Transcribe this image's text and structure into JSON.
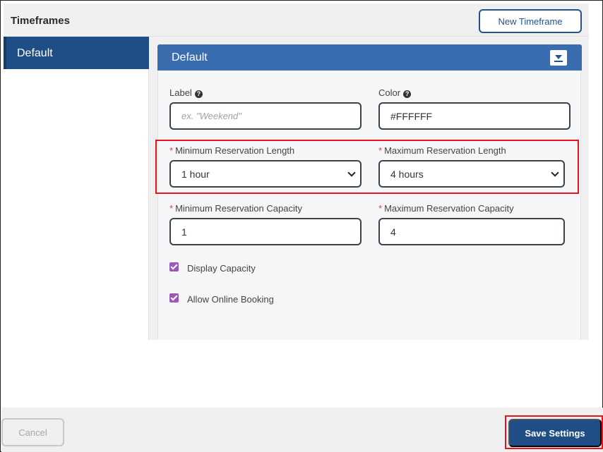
{
  "header": {
    "title": "Timeframes",
    "new_button_label": "New Timeframe"
  },
  "sidebar": {
    "items": [
      {
        "label": "Default"
      }
    ]
  },
  "panel": {
    "title": "Default",
    "label_field": {
      "label": "Label",
      "placeholder": "ex. \"Weekend\"",
      "value": ""
    },
    "color_field": {
      "label": "Color",
      "value": "#FFFFFF"
    },
    "min_length": {
      "label": "Minimum Reservation Length",
      "value": "1 hour"
    },
    "max_length": {
      "label": "Maximum Reservation Length",
      "value": "4 hours"
    },
    "min_capacity": {
      "label": "Minimum Reservation Capacity",
      "value": "1"
    },
    "max_capacity": {
      "label": "Maximum Reservation Capacity",
      "value": "4"
    },
    "display_capacity": {
      "label": "Display Capacity",
      "checked": true
    },
    "allow_online_booking": {
      "label": "Allow Online Booking",
      "checked": true
    },
    "required_marker": "*",
    "help_glyph": "?"
  },
  "footer": {
    "cancel_label": "Cancel",
    "save_label": "Save Settings"
  },
  "colors": {
    "primary": "#1f4e86",
    "panel_header": "#3a6cb0",
    "checkbox": "#9b59b6",
    "required": "#e0454f",
    "highlight": "#e8141c"
  }
}
